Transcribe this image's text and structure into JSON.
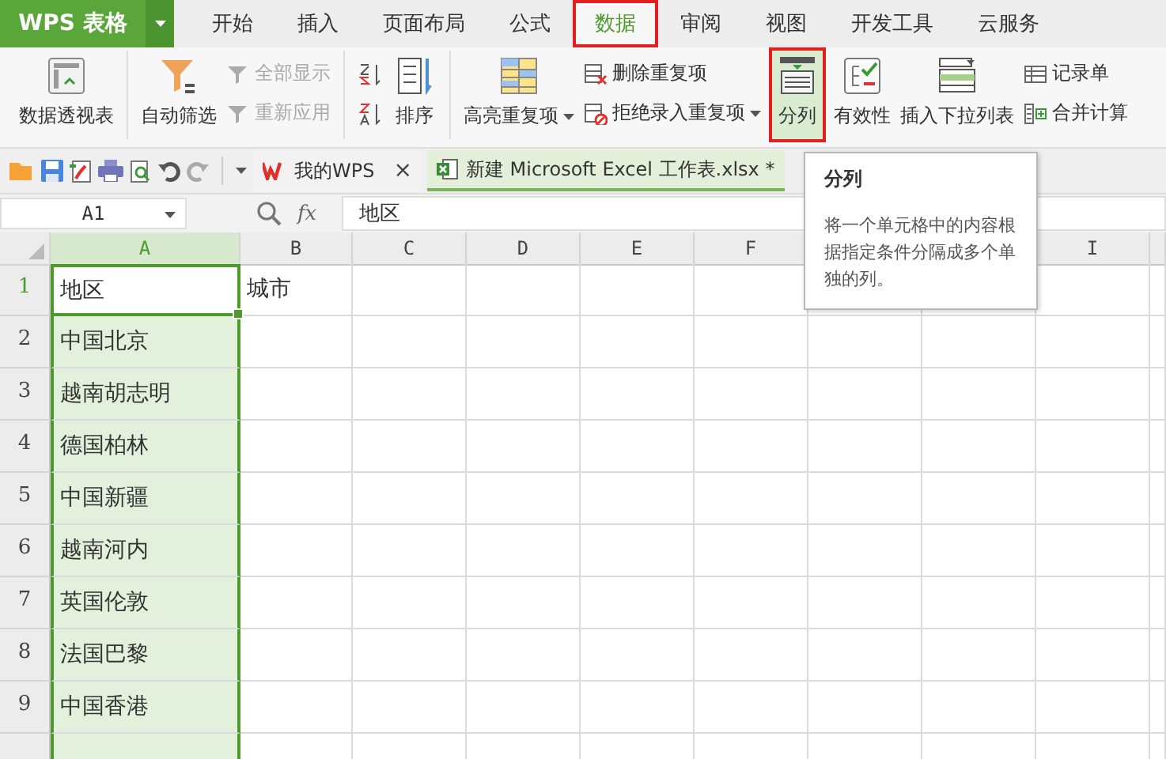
{
  "app": {
    "title": "WPS 表格"
  },
  "menu_tabs": [
    {
      "label": "开始",
      "selected": false,
      "highlighted": false
    },
    {
      "label": "插入",
      "selected": false,
      "highlighted": false
    },
    {
      "label": "页面布局",
      "selected": false,
      "highlighted": false
    },
    {
      "label": "公式",
      "selected": false,
      "highlighted": false
    },
    {
      "label": "数据",
      "selected": true,
      "highlighted": true
    },
    {
      "label": "审阅",
      "selected": false,
      "highlighted": false
    },
    {
      "label": "视图",
      "selected": false,
      "highlighted": false
    },
    {
      "label": "开发工具",
      "selected": false,
      "highlighted": false
    },
    {
      "label": "云服务",
      "selected": false,
      "highlighted": false
    }
  ],
  "ribbon": {
    "groups": [
      {
        "items": [
          {
            "kind": "large",
            "label": "数据透视表",
            "dropdown": false,
            "highlighted": false
          }
        ]
      },
      {
        "items": [
          {
            "kind": "large",
            "label": "自动筛选",
            "dropdown": false,
            "highlighted": false
          },
          {
            "kind": "stack",
            "items": [
              {
                "label": "全部显示",
                "disabled": true,
                "dropdown": false
              },
              {
                "label": "重新应用",
                "disabled": true,
                "dropdown": false
              }
            ]
          }
        ]
      },
      {
        "items": [
          {
            "kind": "iconstack"
          },
          {
            "kind": "large",
            "label": "排序",
            "dropdown": false,
            "highlighted": false
          }
        ]
      },
      {
        "items": [
          {
            "kind": "large",
            "label": "高亮重复项",
            "dropdown": true,
            "highlighted": false
          },
          {
            "kind": "stack",
            "items": [
              {
                "label": "删除重复项",
                "disabled": false,
                "dropdown": false
              },
              {
                "label": "拒绝录入重复项",
                "disabled": false,
                "dropdown": true
              }
            ]
          },
          {
            "kind": "large",
            "label": "分列",
            "dropdown": false,
            "highlighted": true
          },
          {
            "kind": "large",
            "label": "有效性",
            "dropdown": false,
            "highlighted": false
          },
          {
            "kind": "large",
            "label": "插入下拉列表",
            "dropdown": false,
            "highlighted": false
          },
          {
            "kind": "stack",
            "items": [
              {
                "label": "记录单",
                "disabled": false,
                "dropdown": false
              },
              {
                "label": "合并计算",
                "disabled": false,
                "dropdown": false
              }
            ]
          }
        ]
      }
    ]
  },
  "doc_tabs": [
    {
      "label": "我的WPS",
      "selected": false,
      "close_symbol": "×"
    },
    {
      "label": "新建 Microsoft Excel 工作表.xlsx *",
      "selected": true
    }
  ],
  "formula_bar": {
    "cell_ref": "A1",
    "function_label": "fx",
    "formula": "地区"
  },
  "columns": [
    {
      "label": "A",
      "selected": true
    },
    {
      "label": "B",
      "selected": false
    },
    {
      "label": "C",
      "selected": false
    },
    {
      "label": "D",
      "selected": false
    },
    {
      "label": "E",
      "selected": false
    },
    {
      "label": "F",
      "selected": false
    },
    {
      "selected": false
    },
    {
      "selected": false
    },
    {
      "label": "I",
      "selected": false
    }
  ],
  "rows": [
    {
      "number": "1",
      "selected": true,
      "cells": [
        "地区",
        "城市"
      ]
    },
    {
      "number": "2",
      "selected": false,
      "cells": [
        "中国北京"
      ]
    },
    {
      "number": "3",
      "selected": false,
      "cells": [
        "越南胡志明"
      ]
    },
    {
      "number": "4",
      "selected": false,
      "cells": [
        "德国柏林"
      ]
    },
    {
      "number": "5",
      "selected": false,
      "cells": [
        "中国新疆"
      ]
    },
    {
      "number": "6",
      "selected": false,
      "cells": [
        "越南河内"
      ]
    },
    {
      "number": "7",
      "selected": false,
      "cells": [
        "英国伦敦"
      ]
    },
    {
      "number": "8",
      "selected": false,
      "cells": [
        "法国巴黎"
      ]
    },
    {
      "number": "9",
      "selected": false,
      "cells": [
        "中国香港"
      ]
    },
    {
      "selected": false,
      "cells": []
    }
  ],
  "tooltip": {
    "title": "分列",
    "body": "将一个单元格中的内容根据指定条件分隔成多个单独的列。"
  }
}
